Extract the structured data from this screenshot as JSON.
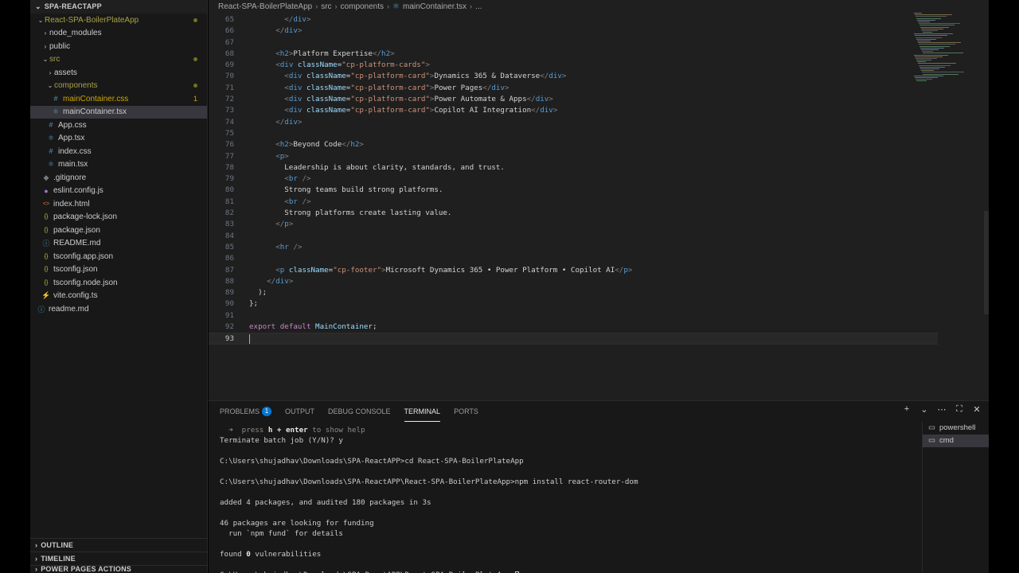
{
  "explorer": {
    "root_label": "SPA-REACTAPP",
    "items": [
      {
        "label": "React-SPA-BoilerPlateApp",
        "depth": 0,
        "chevron": "down",
        "icon": "",
        "state": "src",
        "dot": true
      },
      {
        "label": "node_modules",
        "depth": 1,
        "chevron": "right",
        "icon": "",
        "state": ""
      },
      {
        "label": "public",
        "depth": 1,
        "chevron": "right",
        "icon": "",
        "state": ""
      },
      {
        "label": "src",
        "depth": 1,
        "chevron": "down",
        "icon": "",
        "state": "src",
        "dot": true
      },
      {
        "label": "assets",
        "depth": 2,
        "chevron": "right",
        "icon": "",
        "state": ""
      },
      {
        "label": "components",
        "depth": 2,
        "chevron": "down",
        "icon": "",
        "state": "src",
        "dot": true
      },
      {
        "label": "mainContainer.css",
        "depth": 3,
        "chevron": "",
        "icon": "#",
        "state": "mod",
        "count": "1"
      },
      {
        "label": "mainContainer.tsx",
        "depth": 3,
        "chevron": "",
        "icon": "⚛",
        "state": "selected"
      },
      {
        "label": "App.css",
        "depth": 2,
        "chevron": "",
        "icon": "#",
        "state": ""
      },
      {
        "label": "App.tsx",
        "depth": 2,
        "chevron": "",
        "icon": "⚛",
        "state": ""
      },
      {
        "label": "index.css",
        "depth": 2,
        "chevron": "",
        "icon": "#",
        "state": ""
      },
      {
        "label": "main.tsx",
        "depth": 2,
        "chevron": "",
        "icon": "⚛",
        "state": ""
      },
      {
        "label": ".gitignore",
        "depth": 1,
        "chevron": "",
        "icon": "◆",
        "state": ""
      },
      {
        "label": "eslint.config.js",
        "depth": 1,
        "chevron": "",
        "icon": "●",
        "state": ""
      },
      {
        "label": "index.html",
        "depth": 1,
        "chevron": "",
        "icon": "<>",
        "state": ""
      },
      {
        "label": "package-lock.json",
        "depth": 1,
        "chevron": "",
        "icon": "{}",
        "state": ""
      },
      {
        "label": "package.json",
        "depth": 1,
        "chevron": "",
        "icon": "{}",
        "state": ""
      },
      {
        "label": "README.md",
        "depth": 1,
        "chevron": "",
        "icon": "ⓘ",
        "state": ""
      },
      {
        "label": "tsconfig.app.json",
        "depth": 1,
        "chevron": "",
        "icon": "{}",
        "state": ""
      },
      {
        "label": "tsconfig.json",
        "depth": 1,
        "chevron": "",
        "icon": "{}",
        "state": ""
      },
      {
        "label": "tsconfig.node.json",
        "depth": 1,
        "chevron": "",
        "icon": "{}",
        "state": ""
      },
      {
        "label": "vite.config.ts",
        "depth": 1,
        "chevron": "",
        "icon": "⚡",
        "state": ""
      },
      {
        "label": "readme.md",
        "depth": 0,
        "chevron": "",
        "icon": "ⓘ",
        "state": ""
      }
    ],
    "outline_label": "OUTLINE",
    "timeline_label": "TIMELINE",
    "power_pages_label": "POWER PAGES ACTIONS"
  },
  "breadcrumb": {
    "parts": [
      "React-SPA-BoilerPlateApp",
      "src",
      "components",
      "mainContainer.tsx",
      "..."
    ],
    "file_icon": "react-icon"
  },
  "editor": {
    "current_line": 93,
    "lines": [
      {
        "n": 65,
        "indent": 8,
        "tokens": [
          [
            "tag",
            "</"
          ],
          [
            "el",
            "div"
          ],
          [
            "tag",
            ">"
          ]
        ]
      },
      {
        "n": 66,
        "indent": 6,
        "tokens": [
          [
            "tag",
            "</"
          ],
          [
            "el",
            "div"
          ],
          [
            "tag",
            ">"
          ]
        ]
      },
      {
        "n": 67,
        "indent": 0,
        "tokens": []
      },
      {
        "n": 68,
        "indent": 6,
        "tokens": [
          [
            "tag",
            "<"
          ],
          [
            "el",
            "h2"
          ],
          [
            "tag",
            ">"
          ],
          [
            "txt",
            "Platform Expertise"
          ],
          [
            "tag",
            "</"
          ],
          [
            "el",
            "h2"
          ],
          [
            "tag",
            ">"
          ]
        ]
      },
      {
        "n": 69,
        "indent": 6,
        "tokens": [
          [
            "tag",
            "<"
          ],
          [
            "el",
            "div"
          ],
          [
            "txt",
            " "
          ],
          [
            "attr",
            "className"
          ],
          [
            "txt",
            "="
          ],
          [
            "str",
            "\"cp-platform-cards\""
          ],
          [
            "tag",
            ">"
          ]
        ]
      },
      {
        "n": 70,
        "indent": 8,
        "tokens": [
          [
            "tag",
            "<"
          ],
          [
            "el",
            "div"
          ],
          [
            "txt",
            " "
          ],
          [
            "attr",
            "className"
          ],
          [
            "txt",
            "="
          ],
          [
            "str",
            "\"cp-platform-card\""
          ],
          [
            "tag",
            ">"
          ],
          [
            "txt",
            "Dynamics 365 & Dataverse"
          ],
          [
            "tag",
            "</"
          ],
          [
            "el",
            "div"
          ],
          [
            "tag",
            ">"
          ]
        ]
      },
      {
        "n": 71,
        "indent": 8,
        "tokens": [
          [
            "tag",
            "<"
          ],
          [
            "el",
            "div"
          ],
          [
            "txt",
            " "
          ],
          [
            "attr",
            "className"
          ],
          [
            "txt",
            "="
          ],
          [
            "str",
            "\"cp-platform-card\""
          ],
          [
            "tag",
            ">"
          ],
          [
            "txt",
            "Power Pages"
          ],
          [
            "tag",
            "</"
          ],
          [
            "el",
            "div"
          ],
          [
            "tag",
            ">"
          ]
        ]
      },
      {
        "n": 72,
        "indent": 8,
        "tokens": [
          [
            "tag",
            "<"
          ],
          [
            "el",
            "div"
          ],
          [
            "txt",
            " "
          ],
          [
            "attr",
            "className"
          ],
          [
            "txt",
            "="
          ],
          [
            "str",
            "\"cp-platform-card\""
          ],
          [
            "tag",
            ">"
          ],
          [
            "txt",
            "Power Automate & Apps"
          ],
          [
            "tag",
            "</"
          ],
          [
            "el",
            "div"
          ],
          [
            "tag",
            ">"
          ]
        ]
      },
      {
        "n": 73,
        "indent": 8,
        "tokens": [
          [
            "tag",
            "<"
          ],
          [
            "el",
            "div"
          ],
          [
            "txt",
            " "
          ],
          [
            "attr",
            "className"
          ],
          [
            "txt",
            "="
          ],
          [
            "str",
            "\"cp-platform-card\""
          ],
          [
            "tag",
            ">"
          ],
          [
            "txt",
            "Copilot AI Integration"
          ],
          [
            "tag",
            "</"
          ],
          [
            "el",
            "div"
          ],
          [
            "tag",
            ">"
          ]
        ]
      },
      {
        "n": 74,
        "indent": 6,
        "tokens": [
          [
            "tag",
            "</"
          ],
          [
            "el",
            "div"
          ],
          [
            "tag",
            ">"
          ]
        ]
      },
      {
        "n": 75,
        "indent": 0,
        "tokens": []
      },
      {
        "n": 76,
        "indent": 6,
        "tokens": [
          [
            "tag",
            "<"
          ],
          [
            "el",
            "h2"
          ],
          [
            "tag",
            ">"
          ],
          [
            "txt",
            "Beyond Code"
          ],
          [
            "tag",
            "</"
          ],
          [
            "el",
            "h2"
          ],
          [
            "tag",
            ">"
          ]
        ]
      },
      {
        "n": 77,
        "indent": 6,
        "tokens": [
          [
            "tag",
            "<"
          ],
          [
            "el",
            "p"
          ],
          [
            "tag",
            ">"
          ]
        ]
      },
      {
        "n": 78,
        "indent": 8,
        "tokens": [
          [
            "txt",
            "Leadership is about clarity, standards, and trust."
          ]
        ]
      },
      {
        "n": 79,
        "indent": 8,
        "tokens": [
          [
            "tag",
            "<"
          ],
          [
            "el",
            "br"
          ],
          [
            "txt",
            " "
          ],
          [
            "tag",
            "/>"
          ]
        ]
      },
      {
        "n": 80,
        "indent": 8,
        "tokens": [
          [
            "txt",
            "Strong teams build strong platforms."
          ]
        ]
      },
      {
        "n": 81,
        "indent": 8,
        "tokens": [
          [
            "tag",
            "<"
          ],
          [
            "el",
            "br"
          ],
          [
            "txt",
            " "
          ],
          [
            "tag",
            "/>"
          ]
        ]
      },
      {
        "n": 82,
        "indent": 8,
        "tokens": [
          [
            "txt",
            "Strong platforms create lasting value."
          ]
        ]
      },
      {
        "n": 83,
        "indent": 6,
        "tokens": [
          [
            "tag",
            "</"
          ],
          [
            "el",
            "p"
          ],
          [
            "tag",
            ">"
          ]
        ]
      },
      {
        "n": 84,
        "indent": 0,
        "tokens": []
      },
      {
        "n": 85,
        "indent": 6,
        "tokens": [
          [
            "tag",
            "<"
          ],
          [
            "el",
            "hr"
          ],
          [
            "txt",
            " "
          ],
          [
            "tag",
            "/>"
          ]
        ]
      },
      {
        "n": 86,
        "indent": 0,
        "tokens": []
      },
      {
        "n": 87,
        "indent": 6,
        "tokens": [
          [
            "tag",
            "<"
          ],
          [
            "el",
            "p"
          ],
          [
            "txt",
            " "
          ],
          [
            "attr",
            "className"
          ],
          [
            "txt",
            "="
          ],
          [
            "str",
            "\"cp-footer\""
          ],
          [
            "tag",
            ">"
          ],
          [
            "txt",
            "Microsoft Dynamics 365 • Power Platform • Copilot AI"
          ],
          [
            "tag",
            "</"
          ],
          [
            "el",
            "p"
          ],
          [
            "tag",
            ">"
          ]
        ]
      },
      {
        "n": 88,
        "indent": 4,
        "tokens": [
          [
            "tag",
            "</"
          ],
          [
            "el",
            "div"
          ],
          [
            "tag",
            ">"
          ]
        ]
      },
      {
        "n": 89,
        "indent": 2,
        "tokens": [
          [
            "txt",
            ");"
          ]
        ]
      },
      {
        "n": 90,
        "indent": 0,
        "tokens": [
          [
            "txt",
            "};"
          ]
        ]
      },
      {
        "n": 91,
        "indent": 0,
        "tokens": []
      },
      {
        "n": 92,
        "indent": 0,
        "tokens": [
          [
            "kw",
            "export"
          ],
          [
            "txt",
            " "
          ],
          [
            "kw",
            "default"
          ],
          [
            "txt",
            " "
          ],
          [
            "id",
            "MainContainer"
          ],
          [
            "txt",
            ";"
          ]
        ]
      },
      {
        "n": 93,
        "indent": 0,
        "tokens": []
      }
    ]
  },
  "panel": {
    "tabs": [
      {
        "label": "PROBLEMS",
        "badge": "1",
        "active": false
      },
      {
        "label": "OUTPUT",
        "active": false
      },
      {
        "label": "DEBUG CONSOLE",
        "active": false
      },
      {
        "label": "TERMINAL",
        "active": true
      },
      {
        "label": "PORTS",
        "active": false
      }
    ],
    "actions": [
      "plus-icon",
      "chevron-down-icon",
      "more-icon",
      "maximize-icon",
      "close-icon"
    ],
    "terminal_lines": [
      {
        "parts": [
          [
            "hint",
            "  ➜  press "
          ],
          [
            "bold",
            "h + enter"
          ],
          [
            "hint",
            " to show help"
          ]
        ]
      },
      {
        "parts": [
          [
            "txt",
            "Terminate batch job (Y/N)? y"
          ]
        ]
      },
      {
        "parts": []
      },
      {
        "parts": [
          [
            "txt",
            "C:\\Users\\shujadhav\\Downloads\\SPA-ReactAPP>cd React-SPA-BoilerPlateApp"
          ]
        ]
      },
      {
        "parts": []
      },
      {
        "parts": [
          [
            "txt",
            "C:\\Users\\shujadhav\\Downloads\\SPA-ReactAPP\\React-SPA-BoilerPlateApp>npm install react-router-dom"
          ]
        ]
      },
      {
        "parts": []
      },
      {
        "parts": [
          [
            "txt",
            "added 4 packages, and audited 180 packages in 3s"
          ]
        ]
      },
      {
        "parts": []
      },
      {
        "parts": [
          [
            "txt",
            "46 packages are looking for funding"
          ]
        ]
      },
      {
        "parts": [
          [
            "txt",
            "  run `npm fund` for details"
          ]
        ]
      },
      {
        "parts": []
      },
      {
        "parts": [
          [
            "txt",
            "found "
          ],
          [
            "bold",
            "0"
          ],
          [
            "txt",
            " vulnerabilities"
          ]
        ]
      },
      {
        "parts": []
      },
      {
        "parts": [
          [
            "txt",
            "C:\\Users\\shujadhav\\Downloads\\SPA-ReactAPP\\React-SPA-BoilerPlateApp>"
          ],
          [
            "cursor",
            ""
          ]
        ]
      }
    ],
    "terminals": [
      {
        "label": "powershell",
        "selected": false
      },
      {
        "label": "cmd",
        "selected": true
      }
    ]
  }
}
